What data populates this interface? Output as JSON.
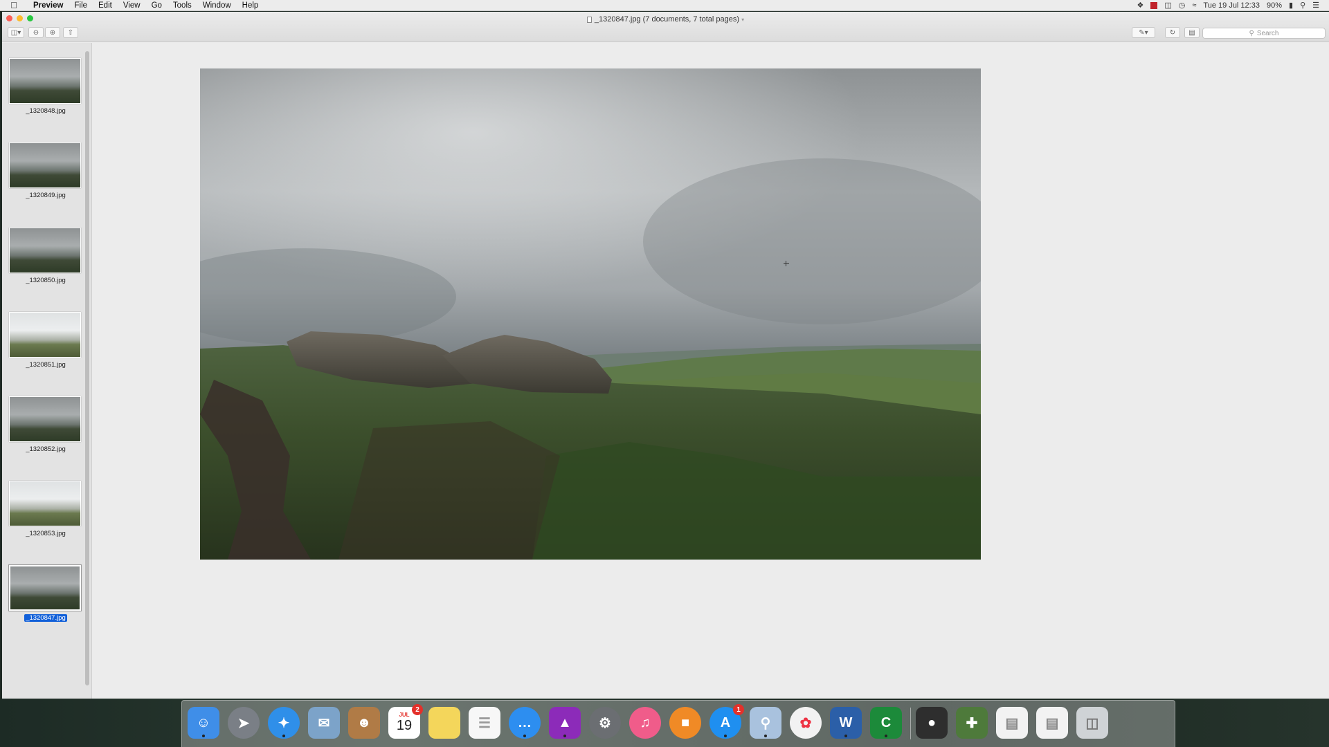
{
  "menubar": {
    "apple_icon": "apple-logo",
    "app_name": "Preview",
    "items": [
      "File",
      "Edit",
      "View",
      "Go",
      "Tools",
      "Window",
      "Help"
    ],
    "datetime": "Tue 19 Jul 12:33",
    "battery": "90%"
  },
  "window": {
    "title": "_1320847.jpg (7 documents, 7 total pages)",
    "search_placeholder": "Search"
  },
  "sidebar": {
    "thumbnails": [
      {
        "label": "_1320848.jpg",
        "tone": "dark"
      },
      {
        "label": "_1320849.jpg",
        "tone": "dark"
      },
      {
        "label": "_1320850.jpg",
        "tone": "dark"
      },
      {
        "label": "_1320851.jpg",
        "tone": "light"
      },
      {
        "label": "_1320852.jpg",
        "tone": "dark"
      },
      {
        "label": "_1320853.jpg",
        "tone": "light"
      },
      {
        "label": "_1320847.jpg",
        "tone": "dark",
        "selected": true
      }
    ]
  },
  "dock": {
    "items": [
      {
        "name": "finder-icon",
        "color": "#3f8ee8"
      },
      {
        "name": "launchpad-icon",
        "color": "#7a7f86"
      },
      {
        "name": "safari-icon",
        "color": "#2f8fe9"
      },
      {
        "name": "mail-icon",
        "color": "#7ca3c9"
      },
      {
        "name": "contacts-icon",
        "color": "#b07b46"
      },
      {
        "name": "calendar-icon",
        "color": "#ffffff",
        "month": "JUL",
        "day": "19",
        "badge": "2"
      },
      {
        "name": "notes-icon",
        "color": "#f4d65b"
      },
      {
        "name": "reminders-icon",
        "color": "#f7f7f7"
      },
      {
        "name": "messages-icon",
        "color": "#2d8ef0"
      },
      {
        "name": "affinity-photo-icon",
        "color": "#8c2bb9"
      },
      {
        "name": "system-preferences-icon",
        "color": "#6b6e72"
      },
      {
        "name": "itunes-icon",
        "color": "#f05c8a"
      },
      {
        "name": "ibooks-icon",
        "color": "#f08a26"
      },
      {
        "name": "app-store-icon",
        "color": "#1f8ff0",
        "badge": "1"
      },
      {
        "name": "preview-icon",
        "color": "#a9c2de"
      },
      {
        "name": "photos-icon",
        "color": "#f2f2f2"
      },
      {
        "name": "word-icon",
        "color": "#2b5fa8",
        "glyph": "W"
      },
      {
        "name": "camtasia-icon",
        "color": "#1c8a3a",
        "glyph": "C"
      },
      {
        "name": "recording-app-icon",
        "color": "#2e2e2e"
      },
      {
        "name": "screen-capture-icon",
        "color": "#4e7a3b"
      },
      {
        "name": "document-stack-icon",
        "color": "#f2f2f2"
      },
      {
        "name": "folder-stack-icon",
        "color": "#f2f2f2"
      },
      {
        "name": "trash-icon",
        "color": "#cfd3d6"
      }
    ]
  }
}
